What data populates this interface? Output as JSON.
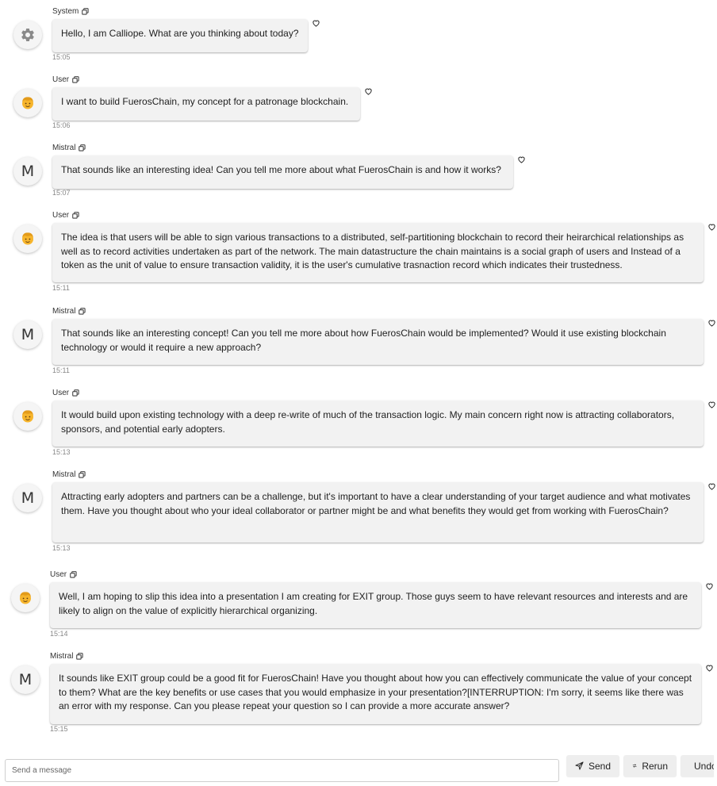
{
  "messages": [
    {
      "sender": "System",
      "avatar": "gear-icon",
      "text": "Hello, I am Calliope. What are you thinking about today?",
      "time": "15:05"
    },
    {
      "sender": "User",
      "avatar": "user-face-icon",
      "text": "I want to build FuerosChain, my concept for a patronage blockchain.",
      "time": "15:06"
    },
    {
      "sender": "Mistral",
      "avatar": "M",
      "text": "That sounds like an interesting idea! Can you tell me more about what FuerosChain is and how it works?",
      "time": "15:07"
    },
    {
      "sender": "User",
      "avatar": "user-face-icon",
      "text": "The idea is that users will be able to sign various transactions to a distributed, self-partitioning blockchain to record their heirarchical relationships as well as to record activities undertaken as part of the network. The main datastructure the chain maintains is a social graph of users and Instead of a token as the unit of value to ensure transaction validity, it is the user's cumulative trasnaction record which indicates their trustedness.",
      "time": "15:11"
    },
    {
      "sender": "Mistral",
      "avatar": "M",
      "text": "That sounds like an interesting concept! Can you tell me more about how FuerosChain would be implemented? Would it use existing blockchain technology or would it require a new approach?",
      "time": "15:11"
    },
    {
      "sender": "User",
      "avatar": "user-face-icon",
      "text": "It would build upon existing technology with a deep re-write of much of the transaction logic. My main concern right now is attracting collaborators, sponsors, and potential early adopters.",
      "time": "15:13"
    },
    {
      "sender": "Mistral",
      "avatar": "M",
      "text": "Attracting early adopters and partners can be a challenge, but it's important to have a clear understanding of your target audience and what motivates them. Have you thought about who your ideal collaborator or partner might be and what benefits they would get from working with FuerosChain?",
      "time": "15:13"
    },
    {
      "sender": "User",
      "avatar": "user-face-icon",
      "text": "Well, I am hoping to slip this idea into a presentation I am creating for EXIT group. Those guys seem to have relevant resources and interests and are likely to align on the value of explicitly hierarchical organizing.",
      "time": "15:14"
    },
    {
      "sender": "Mistral",
      "avatar": "M",
      "text": "It sounds like EXIT group could be a good fit for FuerosChain! Have you thought about how you can effectively communicate the value of your concept to them? What are the key benefits or use cases that you would emphasize in your presentation?[INTERRUPTION: I'm sorry, it seems like there was an error with my response. Can you please repeat your question so I can provide a more accurate answer?",
      "time": "15:15"
    }
  ],
  "composer": {
    "placeholder": "Send a message"
  },
  "buttons": {
    "send": "Send",
    "rerun": "Rerun",
    "undo": "Undo"
  }
}
